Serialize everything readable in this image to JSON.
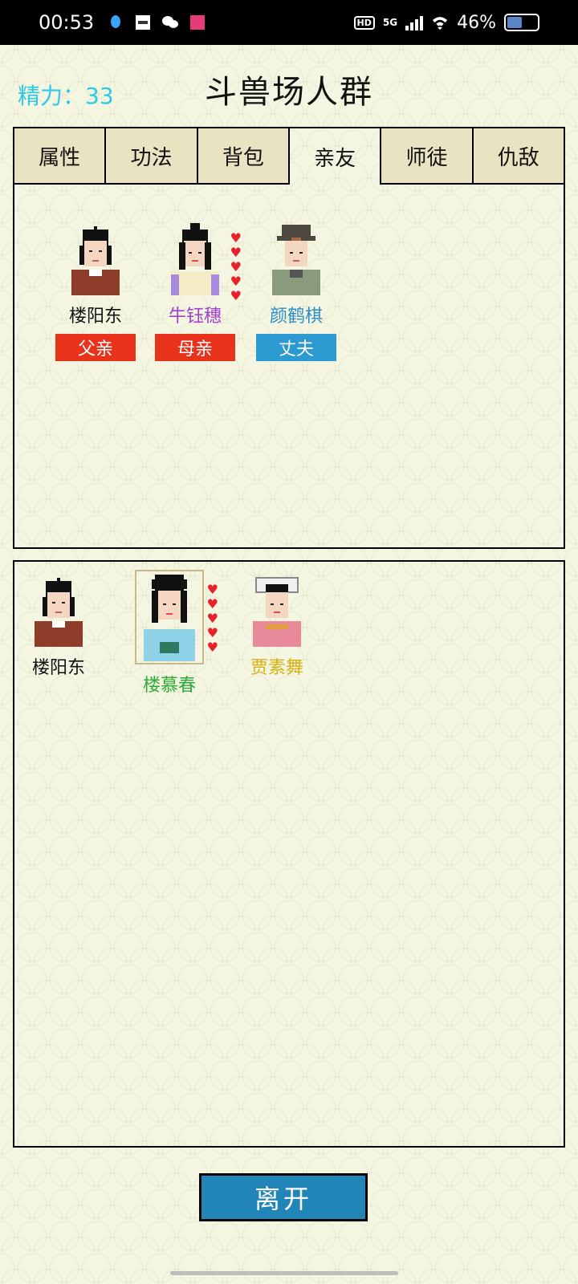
{
  "status": {
    "time": "00:53",
    "hd": "HD",
    "network": "5G",
    "battery": "46%"
  },
  "header": {
    "energy": "精力：33",
    "title": "斗兽场人群"
  },
  "tabs": [
    {
      "label": "属性"
    },
    {
      "label": "功法"
    },
    {
      "label": "背包"
    },
    {
      "label": "亲友",
      "active": true
    },
    {
      "label": "师徒"
    },
    {
      "label": "仇敌"
    }
  ],
  "relatives": [
    {
      "name": "楼阳东",
      "relation": "父亲",
      "name_color": "#111111",
      "tag_color": "#e8321c",
      "hearts": 0
    },
    {
      "name": "牛钰穗",
      "relation": "母亲",
      "name_color": "#a23fd0",
      "tag_color": "#e8321c",
      "hearts": 5
    },
    {
      "name": "颜鹤棋",
      "relation": "丈夫",
      "name_color": "#2a8ec8",
      "tag_color": "#2a9ad0",
      "hearts": 0
    }
  ],
  "crowd": [
    {
      "name": "楼阳东",
      "name_color": "#111111",
      "hearts": 0
    },
    {
      "name": "楼慕春",
      "name_color": "#2eaa36",
      "hearts": 5
    },
    {
      "name": "贾素舞",
      "name_color": "#d6b012",
      "hearts": 0
    }
  ],
  "footer": {
    "leave_label": "离开"
  }
}
